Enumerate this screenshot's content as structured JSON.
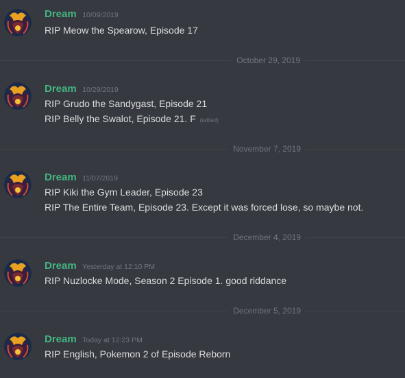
{
  "messages": [
    {
      "username": "Dream",
      "timestamp": "10/09/2019",
      "lines": [
        "RIP Meow the Spearow, Episode 17"
      ]
    },
    {
      "username": "Dream",
      "timestamp": "10/29/2019",
      "lines": [
        "RIP Grudo the Sandygast, Episode 21",
        "RIP Belly the Swalot, Episode 21. F"
      ],
      "edited": "(edited)"
    },
    {
      "username": "Dream",
      "timestamp": "11/07/2019",
      "lines": [
        "RIP Kiki the Gym Leader, Episode 23",
        "RIP The Entire Team, Episode 23. Except it was forced lose, so maybe not."
      ]
    },
    {
      "username": "Dream",
      "timestamp": "Yesterday at 12:10 PM",
      "lines": [
        "RIP Nuzlocke Mode, Season 2 Episode 1. good riddance"
      ]
    },
    {
      "username": "Dream",
      "timestamp": "Today at 12:23 PM",
      "lines": [
        "RIP English, Pokemon 2 of Episode Reborn"
      ]
    }
  ],
  "dividers": [
    "October 29, 2019",
    "November 7, 2019",
    "December 4, 2019",
    "December 5, 2019"
  ],
  "colors": {
    "background": "#36393f",
    "username": "#43b581",
    "text": "#dcddde",
    "muted": "#72767d",
    "divider": "#42454a"
  },
  "avatar_icon": "avatar-dream"
}
